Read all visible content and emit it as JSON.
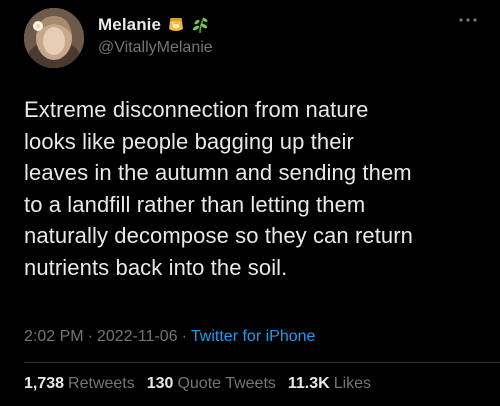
{
  "tweet": {
    "author": {
      "display_name": "Melanie",
      "handle": "@VitallyMelanie",
      "emojis": [
        "honey-pot-icon",
        "herb-icon"
      ]
    },
    "text": "Extreme disconnection from nature\nlooks like people bagging up their\nleaves in the autumn and sending them\nto a landfill rather than letting them\nnaturally decompose so they can return\nnutrients back into the soil.",
    "time": "2:02 PM",
    "separator": "·",
    "date": "2022-11-06",
    "source": "Twitter for iPhone",
    "stats": {
      "retweets_count": "1,738",
      "retweets_label": "Retweets",
      "quote_count": "130",
      "quote_label": "Quote Tweets",
      "likes_count": "11.3K",
      "likes_label": "Likes"
    }
  },
  "colors": {
    "background": "#000000",
    "primary_text": "#e7e9ea",
    "secondary_text": "#71767b",
    "link": "#1d9bf0",
    "divider": "#2f3336"
  }
}
